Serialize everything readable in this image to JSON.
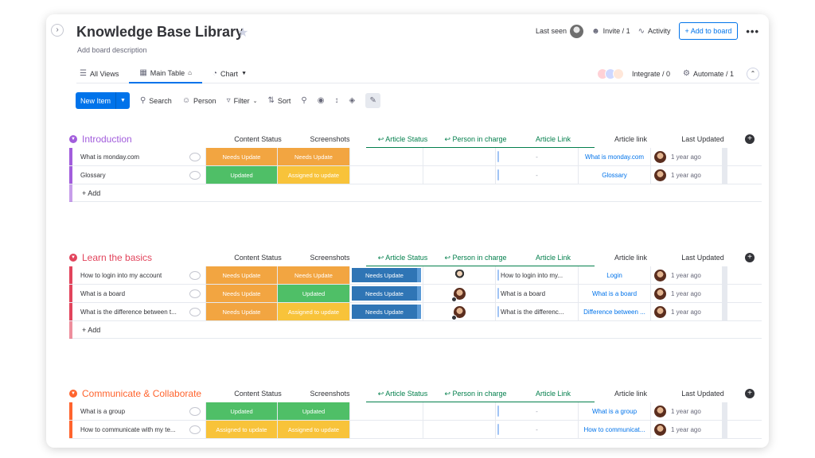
{
  "board": {
    "title": "Knowledge Base Library",
    "description": "Add board description",
    "star_icon": "star-icon"
  },
  "topbar": {
    "last_seen": "Last seen",
    "invite": "Invite / 1",
    "activity": "Activity",
    "add_to_board": "+ Add to board",
    "more": "•••"
  },
  "views": {
    "all_views": "All Views",
    "main_table": "Main Table",
    "chart": "Chart",
    "integrate": "Integrate / 0",
    "automate": "Automate / 1"
  },
  "toolbar": {
    "new_item": "New Item",
    "search": "Search",
    "person": "Person",
    "filter": "Filter",
    "sort": "Sort"
  },
  "columns": [
    "Content Status",
    "Screenshots",
    "Article Status",
    "Person in charge",
    "Article Link",
    "Article link",
    "Last Updated"
  ],
  "colors": {
    "needs_update_orange": "#f2a541",
    "updated_green": "#4fbf67",
    "assigned_yellow": "#f8c33a",
    "needs_update_blue": "#2f75b5",
    "link_blue": "#0073ea",
    "introduction": "#a25ddc",
    "learn_basics": "#e2445c",
    "communicate": "#ff642e"
  },
  "groups": [
    {
      "name": "Introduction",
      "add_label": "+ Add",
      "rows": [
        {
          "item": "What is monday.com",
          "content": "Needs Update",
          "screens": "Needs Update",
          "article_status": "",
          "person": "",
          "article_text": "-",
          "link": "What is monday.com",
          "updated": "1 year ago"
        },
        {
          "item": "Glossary",
          "content": "Updated",
          "screens": "Assigned to update",
          "article_status": "",
          "person": "",
          "article_text": "-",
          "link": "Glossary",
          "updated": "1 year ago"
        }
      ]
    },
    {
      "name": "Learn the basics",
      "add_label": "+ Add",
      "rows": [
        {
          "item": "How to login into my account",
          "content": "Needs Update",
          "screens": "Needs Update",
          "article_status": "Needs Update",
          "person": "man",
          "article_text": "How to login into my...",
          "link": "Login",
          "updated": "1 year ago"
        },
        {
          "item": "What is a board",
          "content": "Needs Update",
          "screens": "Updated",
          "article_status": "Needs Update",
          "person": "woman",
          "article_text": "What is a board",
          "link": "What is a board",
          "updated": "1 year ago"
        },
        {
          "item": "What is the difference between t...",
          "content": "Needs Update",
          "screens": "Assigned to update",
          "article_status": "Needs Update",
          "person": "woman",
          "article_text": "What is the differenc...",
          "link": "Difference between ...",
          "updated": "1 year ago"
        }
      ]
    },
    {
      "name": "Communicate & Collaborate",
      "add_label": "",
      "rows": [
        {
          "item": "What is a group",
          "content": "Updated",
          "screens": "Updated",
          "article_status": "",
          "person": "",
          "article_text": "-",
          "link": "What is a group",
          "updated": "1 year ago"
        },
        {
          "item": "How to communicate with my te...",
          "content": "Assigned to update",
          "screens": "Assigned to update",
          "article_status": "",
          "person": "",
          "article_text": "-",
          "link": "How to communicat...",
          "updated": "1 year ago"
        }
      ]
    }
  ]
}
